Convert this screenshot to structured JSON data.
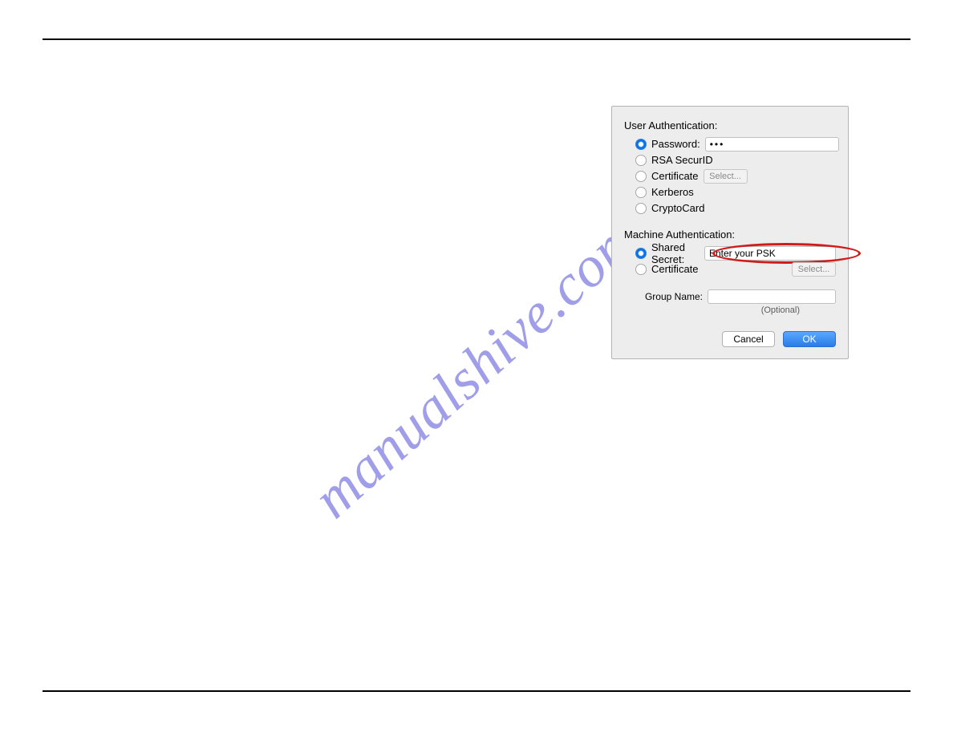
{
  "watermark_text": "manualshive.com",
  "dialog": {
    "user_auth_title": "User Authentication:",
    "options": {
      "password_label": "Password:",
      "password_value": "•••",
      "rsa_label": "RSA SecurID",
      "cert_label": "Certificate",
      "cert_select_label": "Select...",
      "kerberos_label": "Kerberos",
      "cryptocard_label": "CryptoCard"
    },
    "machine_auth_title": "Machine Authentication:",
    "machine": {
      "shared_secret_label": "Shared Secret:",
      "shared_secret_value": "Enter your PSK",
      "cert_label": "Certificate",
      "cert_select_label": "Select..."
    },
    "group_name_label": "Group Name:",
    "optional_label": "(Optional)",
    "cancel_label": "Cancel",
    "ok_label": "OK"
  }
}
